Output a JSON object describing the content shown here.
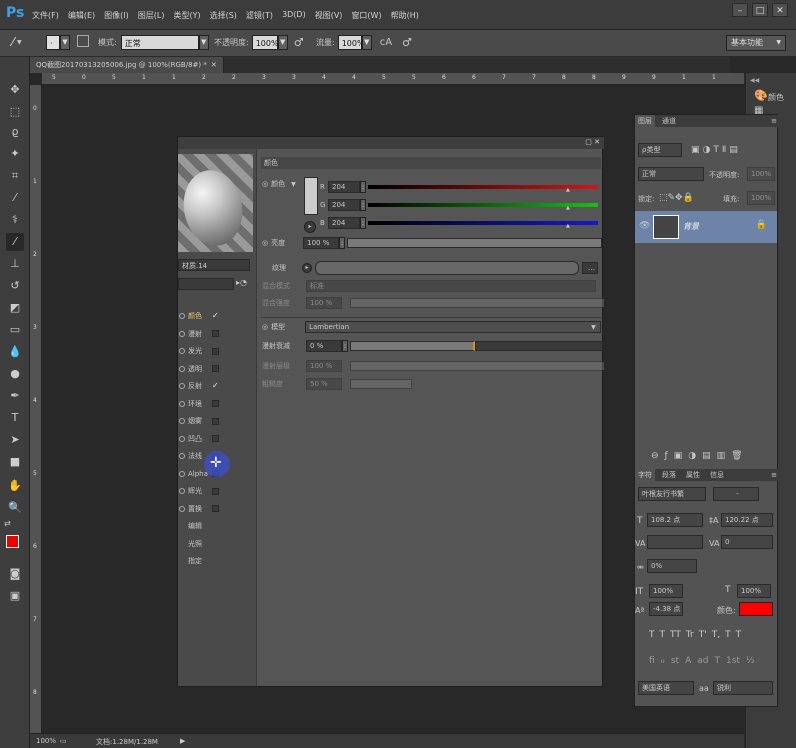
{
  "app": {
    "logo": "Ps",
    "menu": [
      "文件(F)",
      "编辑(E)",
      "图像(I)",
      "图层(L)",
      "类型(Y)",
      "选择(S)",
      "滤镜(T)",
      "3D(D)",
      "视图(V)",
      "窗口(W)",
      "帮助(H)"
    ]
  },
  "options": {
    "mode_label": "模式:",
    "mode_value": "正常",
    "opacity_label": "不透明度:",
    "opacity_value": "100%",
    "flow_label": "流量:",
    "flow_value": "100%",
    "workspace": "基本功能"
  },
  "document": {
    "tab": "QQ截图20170313205006.jpg @ 100%(RGB/8#) *",
    "zoom": "100%",
    "docsize": "文档:1.28M/1.28M"
  },
  "ruler": {
    "h": [
      "5",
      "0",
      "5",
      "1",
      "1",
      "2",
      "2",
      "3",
      "3",
      "4",
      "4",
      "5",
      "5",
      "6",
      "6",
      "7",
      "7",
      "8",
      "8",
      "9",
      "9",
      "1",
      "1"
    ],
    "v": [
      "0",
      "1",
      "2",
      "3",
      "4",
      "5",
      "6",
      "7",
      "8"
    ]
  },
  "material": {
    "name": "材质.14",
    "channels": [
      {
        "label": "颜色",
        "checked": true,
        "hi": true
      },
      {
        "label": "漫射",
        "checked": false,
        "hi": false
      },
      {
        "label": "发光",
        "checked": false,
        "hi": false
      },
      {
        "label": "透明",
        "checked": false,
        "hi": false
      },
      {
        "label": "反射",
        "checked": true,
        "hi": false
      },
      {
        "label": "环境",
        "checked": false,
        "hi": false
      },
      {
        "label": "烟雾",
        "checked": false,
        "hi": false
      },
      {
        "label": "凹凸",
        "checked": false,
        "hi": false
      },
      {
        "label": "法线",
        "checked": false,
        "hi": false
      },
      {
        "label": "Alpha",
        "checked": false,
        "hi": false
      },
      {
        "label": "辉光",
        "checked": false,
        "hi": false
      },
      {
        "label": "置换",
        "checked": false,
        "hi": false
      }
    ],
    "extra": [
      "编辑",
      "光照",
      "指定"
    ],
    "section": "颜色",
    "color_label": "颜色",
    "r_label": "R",
    "g_label": "G",
    "b_label": "B",
    "r": "204",
    "g": "204",
    "b": "204",
    "brightness_label": "亮度",
    "brightness": "100 %",
    "texture_label": "纹理",
    "blend_mode_label": "混合模式",
    "blend_mode": "标准",
    "blend_strength_label": "混合强度",
    "blend_strength": "100 %",
    "model_label": "模型",
    "model": "Lambertian",
    "diffuse_falloff_label": "漫射衰减",
    "diffuse_falloff": "0 %",
    "diffuse_level_label": "漫射层级",
    "diffuse_level": "100 %",
    "roughness_label": "粗糙度",
    "roughness": "50 %",
    "colors": {
      "r": "#d01818",
      "g": "#18c018",
      "b": "#1818c8",
      "accent": "#3a6bd0"
    }
  },
  "layers": {
    "tabs": [
      "图层",
      "通道"
    ],
    "kind": "ρ类型",
    "blend": "正常",
    "opacity_label": "不透明度:",
    "opacity": "100%",
    "lock_label": "锁定:",
    "fill_label": "填充:",
    "fill": "100%",
    "layer_name": "背景"
  },
  "char": {
    "tabs": [
      "字符",
      "段落",
      "属性",
      "信息"
    ],
    "font": "叶根友行书繁",
    "style": "-",
    "size": "108.2 点",
    "leading": "120.22 点",
    "kern": "",
    "tracking": "0",
    "scale_pct": "0%",
    "vscale": "100%",
    "hscale": "100%",
    "baseline": "-4.38 点",
    "color_label": "颜色:",
    "color": "#ff0000",
    "styles": [
      "T",
      "T",
      "TT",
      "Tr",
      "T'",
      "T,",
      "T",
      "T"
    ],
    "ot": [
      "fi",
      "ℴ",
      "st",
      "A",
      "ad",
      "T",
      "1st",
      "½"
    ],
    "lang": "美国英语",
    "aa_label": "aa",
    "aa": "锐利"
  },
  "dock": {
    "color_label": "颜色"
  }
}
